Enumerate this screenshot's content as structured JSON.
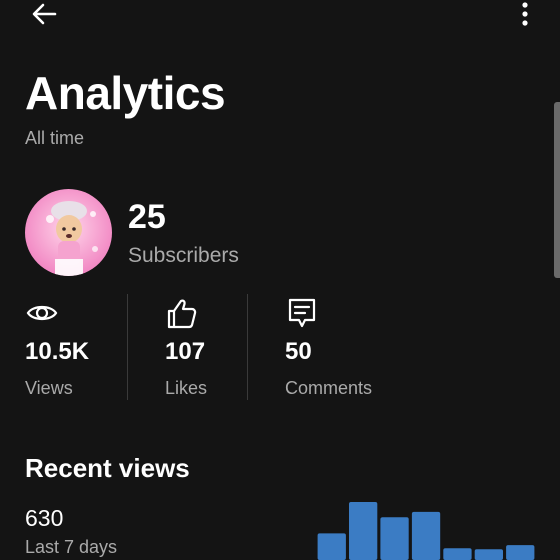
{
  "header": {
    "back_icon": "back-arrow-icon",
    "more_icon": "more-vert-icon"
  },
  "title": "Analytics",
  "period": "All time",
  "channel": {
    "subscribers_count": "25",
    "subscribers_label": "Subscribers"
  },
  "stats": [
    {
      "icon": "eye-icon",
      "value": "10.5K",
      "label": "Views"
    },
    {
      "icon": "thumbs-up-icon",
      "value": "107",
      "label": "Likes"
    },
    {
      "icon": "comment-icon",
      "value": "50",
      "label": "Comments"
    }
  ],
  "recent": {
    "title": "Recent views",
    "count": "630",
    "period": "Last 7 days"
  },
  "colors": {
    "background": "#141414",
    "bar": "#3b7cc4",
    "secondary_text": "#aaaaaa"
  },
  "chart_data": {
    "type": "bar",
    "values": [
      120,
      295,
      210,
      240,
      38,
      32,
      55
    ]
  }
}
